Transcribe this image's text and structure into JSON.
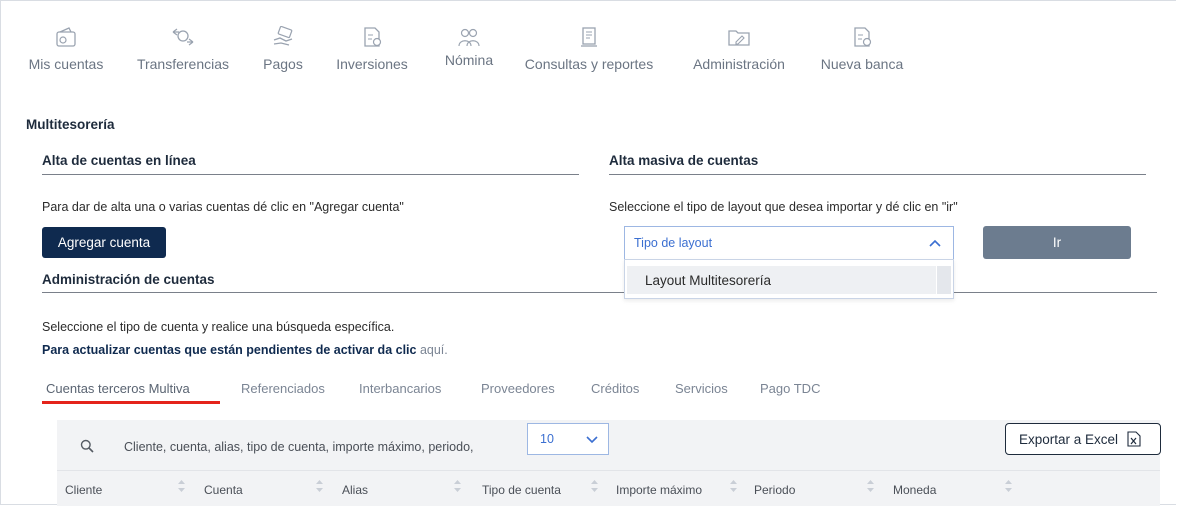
{
  "nav": {
    "items": [
      {
        "label": "Mis cuentas",
        "icon": "wallet-icon"
      },
      {
        "label": "Transferencias",
        "icon": "transfer-icon"
      },
      {
        "label": "Pagos",
        "icon": "payment-hand-icon"
      },
      {
        "label": "Inversiones",
        "icon": "investment-doc-icon"
      },
      {
        "label": "Nómina",
        "icon": "people-icon"
      },
      {
        "label": "Consultas y reportes",
        "icon": "report-icon"
      },
      {
        "label": "Administración",
        "icon": "folder-edit-icon"
      },
      {
        "label": "Nueva banca",
        "icon": "new-bank-icon"
      }
    ]
  },
  "page": {
    "title": "Multitesorería"
  },
  "alta_linea": {
    "title": "Alta de cuentas en línea",
    "instruction": "Para dar de alta una o varias cuentas dé clic en \"Agregar cuenta\"",
    "button": "Agregar cuenta"
  },
  "alta_masiva": {
    "title": "Alta masiva de cuentas",
    "instruction": "Seleccione el tipo de layout que desea importar y dé clic en \"ir\"",
    "select_placeholder": "Tipo de layout",
    "option": "Layout Multitesorería",
    "go_button": "Ir"
  },
  "admin": {
    "title": "Administración de cuentas",
    "instruction": "Seleccione el tipo de cuenta y realice una búsqueda específica.",
    "pending_bold": "Para actualizar cuentas que están pendientes de activar da clic",
    "pending_link": "aquí."
  },
  "tabs": [
    "Cuentas terceros Multiva",
    "Referenciados",
    "Interbancarios",
    "Proveedores",
    "Créditos",
    "Servicios",
    "Pago TDC"
  ],
  "toolbar": {
    "search_placeholder": "Cliente, cuenta, alias, tipo de cuenta, importe máximo, periodo,",
    "per_page": "10",
    "export_label": "Exportar a Excel"
  },
  "table": {
    "columns": [
      "Cliente",
      "Cuenta",
      "Alias",
      "Tipo de cuenta",
      "Importe máximo",
      "Periodo",
      "Moneda"
    ]
  },
  "colors": {
    "primary_navy": "#0f2a4f",
    "tab_active_underline": "#e4231b",
    "select_border": "#9db7e3",
    "go_button": "#6c7c8f"
  }
}
